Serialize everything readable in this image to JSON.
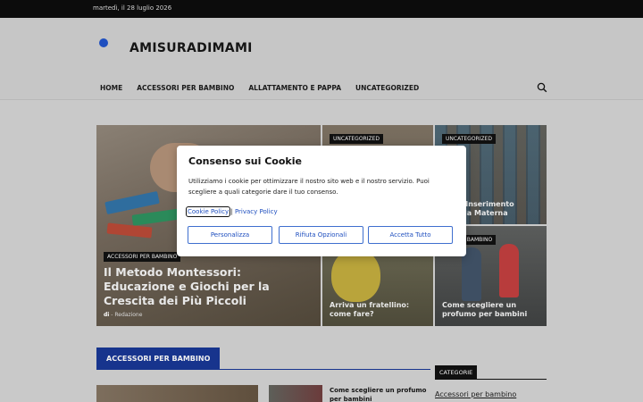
{
  "topbar": {
    "date": "martedì, il 28 luglio 2026"
  },
  "header": {
    "logo": "AMISURADIMAMI",
    "nav": [
      "HOME",
      "ACCESSORI PER BAMBINO",
      "ALLATTAMENTO E PAPPA",
      "UNCATEGORIZED"
    ],
    "search_icon": "search-icon"
  },
  "featured": {
    "main": {
      "category": "ACCESSORI PER BAMBINO",
      "title": "Il Metodo Montessori: Educazione e Giochi per la Crescita dei Più Piccoli",
      "by": "di",
      "author": "- Redazione"
    },
    "top_middle": {
      "category": "UNCATEGORIZED"
    },
    "top_right": {
      "category": "UNCATEGORIZED",
      "title": "...ini: Inserimento ...cuola Materna"
    },
    "bottom_middle": {
      "title": "Arriva un fratellino: come fare?"
    },
    "bottom_right": {
      "category": "...ORI PER BAMBINO",
      "title": "Come scegliere un profumo per bambini"
    }
  },
  "section": {
    "heading": "ACCESSORI PER BAMBINO",
    "list_title": "Come scegliere un profumo per bambini"
  },
  "sidebar": {
    "widget_heading": "CATEGORIE",
    "first_link": "Accessori per bambino"
  },
  "cookie_modal": {
    "title": "Consenso sui Cookie",
    "text": "Utilizziamo i cookie per ottimizzare il nostro sito web e il nostro servizio. Puoi scegliere a quali categorie dare il tuo consenso.",
    "link_cookie_policy": "Cookie Policy",
    "separator": "|",
    "link_privacy_policy": "Privacy Policy",
    "btn_customize": "Personalizza",
    "btn_reject": "Rifiuta Opzionali",
    "btn_accept": "Accetta Tutto"
  },
  "colors": {
    "brand_blue": "#17348d",
    "link_blue": "#1f4fbf",
    "topbar": "#0c0c0c"
  }
}
